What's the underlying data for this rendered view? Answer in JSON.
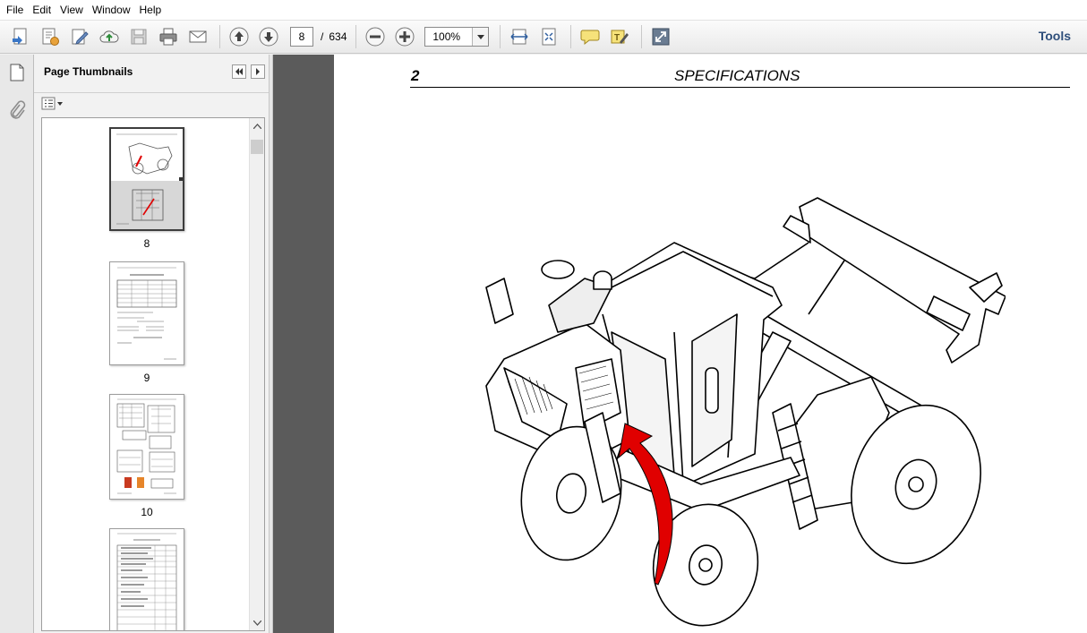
{
  "menu": [
    "File",
    "Edit",
    "View",
    "Window",
    "Help"
  ],
  "toolbar": {
    "current_page": "8",
    "page_separator": "/",
    "total_pages": "634",
    "zoom": "100%",
    "tools_label": "Tools"
  },
  "panel": {
    "title": "Page Thumbnails"
  },
  "thumbnails": [
    {
      "label": "8"
    },
    {
      "label": "9"
    },
    {
      "label": "10"
    }
  ],
  "document": {
    "page_number": "2",
    "heading": "SPECIFICATIONS"
  },
  "colors": {
    "accent_arrow": "#e00000",
    "tools_text": "#2f4f7b",
    "doc_background": "#5b5b5b"
  }
}
